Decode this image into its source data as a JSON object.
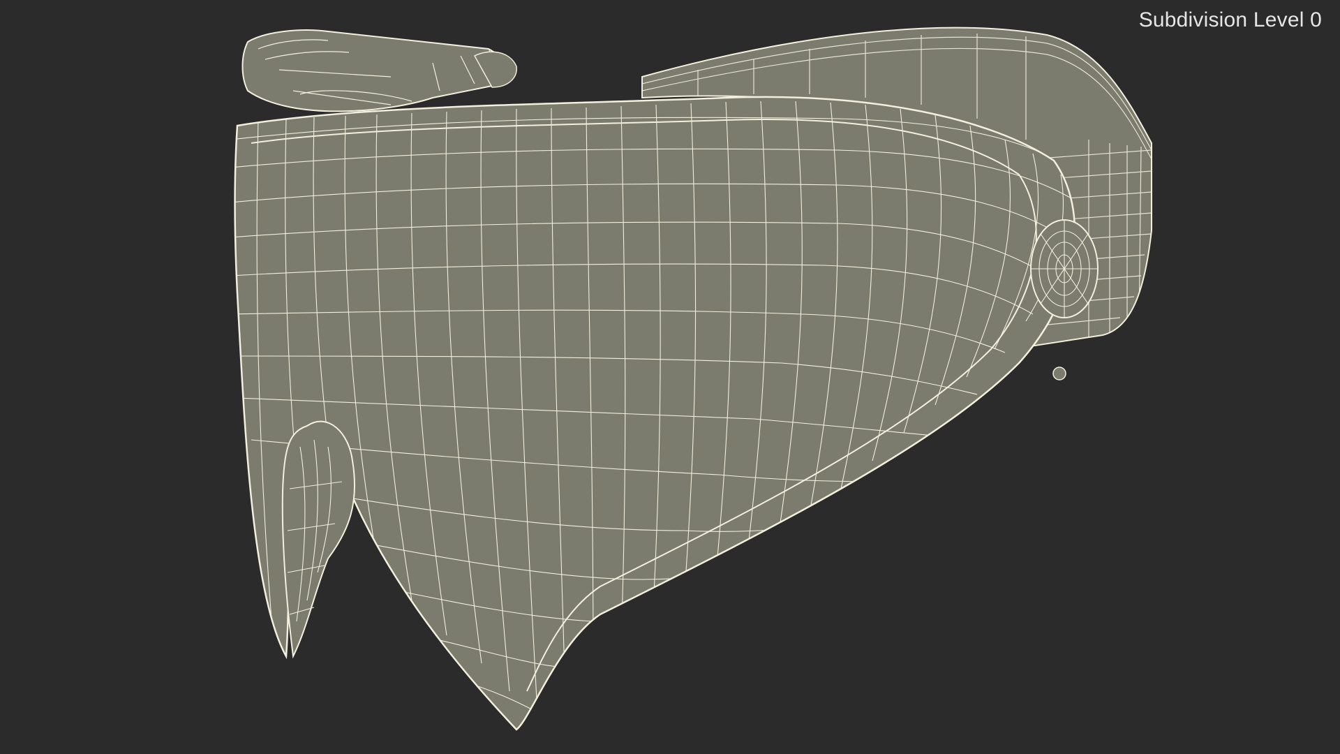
{
  "viewport": {
    "label": "Subdivision Level 0",
    "background_color": "#2b2b2b",
    "mesh_fill_color": "#7b7b6e",
    "wire_color": "#f2f0dc"
  },
  "model": {
    "subject": "goggles-wireframe-render"
  }
}
